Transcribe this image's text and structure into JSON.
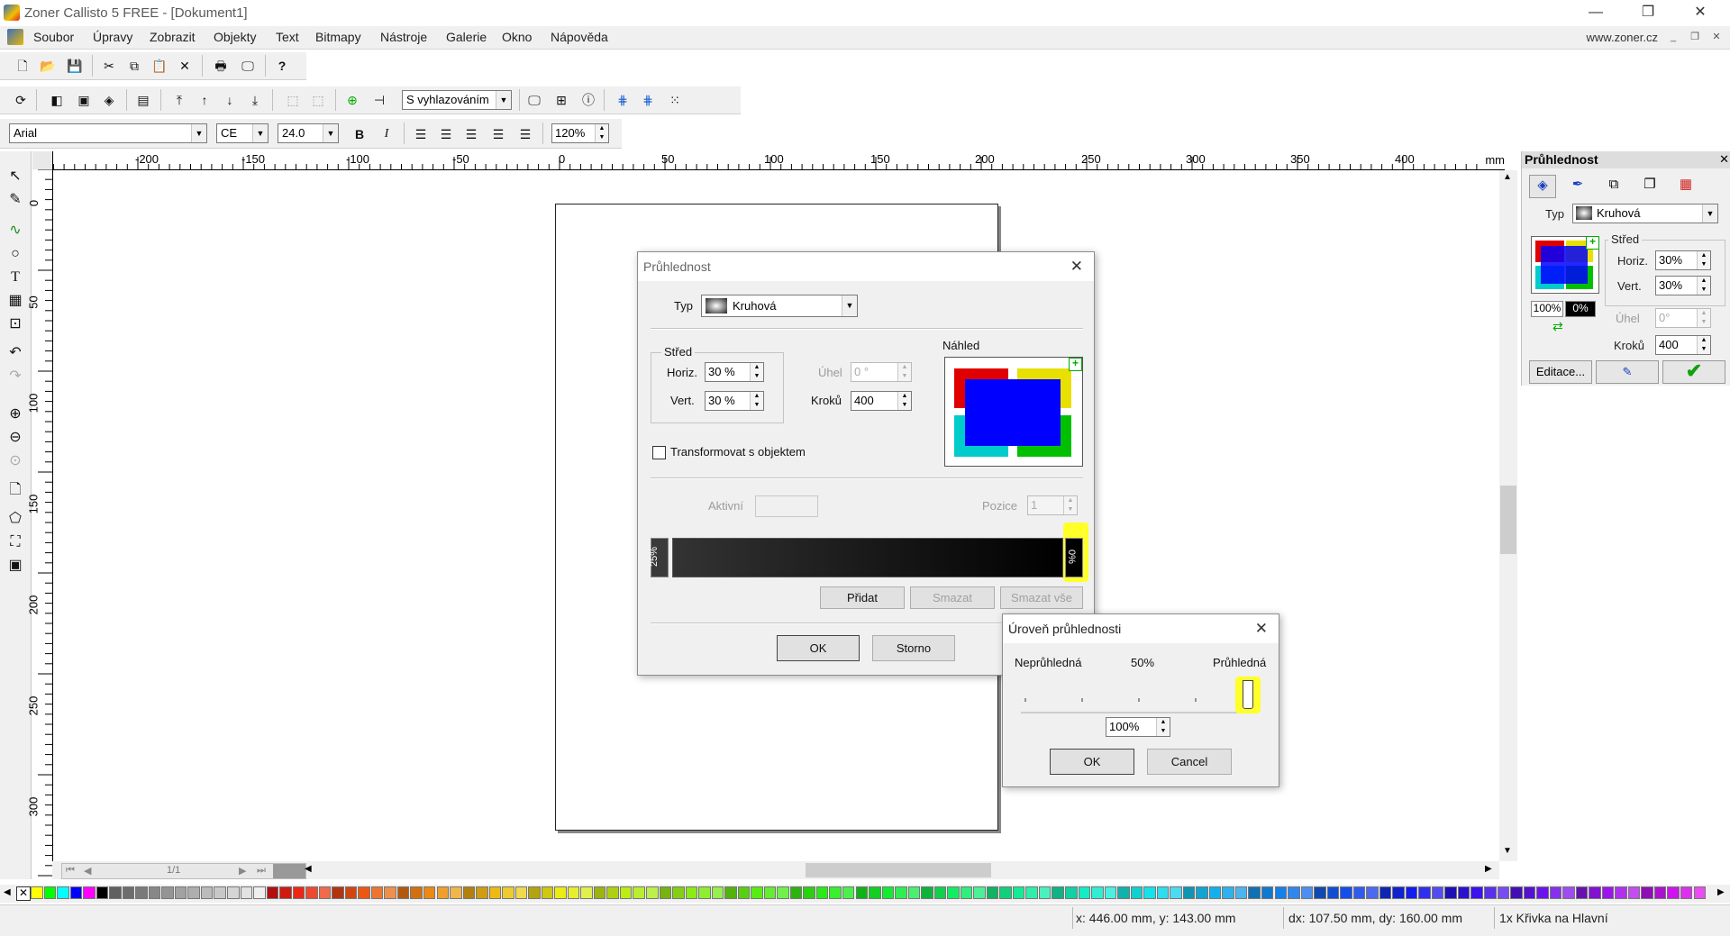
{
  "window": {
    "title": "Zoner Callisto 5 FREE - [Dokument1]",
    "minimize": "—",
    "restore": "❐",
    "close": "✕"
  },
  "menu": {
    "items": [
      "Soubor",
      "Úpravy",
      "Zobrazit",
      "Objekty",
      "Text",
      "Bitmapy",
      "Nástroje",
      "Galerie",
      "Okno",
      "Nápověda"
    ],
    "site": "www.zoner.cz",
    "mdi": [
      "_",
      "❐",
      "✕"
    ]
  },
  "toolbar2": {
    "smoothing": "S vyhlazováním"
  },
  "toolbar3": {
    "font": "Arial",
    "charset": "CE",
    "size": "24.0",
    "bold": "B",
    "italic": "I",
    "zoom": "120%"
  },
  "ruler": {
    "unit": "mm",
    "top_labels": [
      "-200",
      "-150",
      "-100",
      "-50",
      "0",
      "50",
      "100",
      "150",
      "200",
      "250",
      "300",
      "350",
      "400"
    ],
    "left_labels": [
      "0",
      "50",
      "100",
      "150",
      "200",
      "250",
      "300"
    ]
  },
  "page_nav": {
    "current": "1/1"
  },
  "status": {
    "coords": "x: 446.00 mm, y: 143.00 mm",
    "delta": "dx: 107.50 mm, dy: 160.00 mm",
    "selection": "1x Křivka na Hlavní"
  },
  "panel": {
    "title": "Průhlednost",
    "typ_label": "Typ",
    "typ_value": "Kruhová",
    "stred_label": "Střed",
    "horiz_label": "Horiz.",
    "horiz_value": "30%",
    "vert_label": "Vert.",
    "vert_value": "30%",
    "uhel_label": "Úhel",
    "uhel_value": "0°",
    "kroku_label": "Kroků",
    "kroku_value": "400",
    "pct_left": "100%",
    "pct_right": "0%",
    "edit_button": "Editace..."
  },
  "dialog_main": {
    "title": "Průhlednost",
    "typ_label": "Typ",
    "typ_value": "Kruhová",
    "stred_label": "Střed",
    "horiz_label": "Horiz.",
    "horiz_value": "30 %",
    "vert_label": "Vert.",
    "vert_value": "30 %",
    "uhel_label": "Úhel",
    "uhel_value": "0 °",
    "kroku_label": "Kroků",
    "kroku_value": "400",
    "preview_label": "Náhled",
    "transform_label": "Transformovat s objektem",
    "aktivni_label": "Aktivní",
    "pozice_label": "Pozice",
    "pozice_value": "1",
    "marker_left": "25%",
    "marker_right": "0%",
    "add_button": "Přidat",
    "delete_button": "Smazat",
    "delete_all_button": "Smazat vše",
    "ok_button": "OK",
    "cancel_button": "Storno"
  },
  "dialog_level": {
    "title": "Úroveň průhlednosti",
    "label_left": "Neprůhledná",
    "label_mid": "50%",
    "label_right": "Průhledná",
    "slider_level": 1.0,
    "value": "100%",
    "ok_button": "OK",
    "cancel_button": "Cancel"
  },
  "colors": {
    "highlight": "#ffff2a",
    "preview_blue": "#0000ff",
    "accent_green": "#10a010"
  }
}
